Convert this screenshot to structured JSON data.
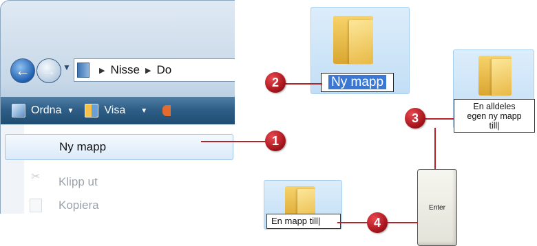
{
  "explorer": {
    "address_path": [
      "Nisse",
      "Do"
    ],
    "toolbar": {
      "organize_label": "Ordna",
      "view_label": "Visa"
    },
    "menu": {
      "new_folder": "Ny mapp",
      "cut": "Klipp ut",
      "copy": "Kopiera"
    }
  },
  "steps": {
    "one": "1",
    "two": "2",
    "three": "3",
    "four": "4"
  },
  "folders": {
    "rename_selected": "Ny mapp",
    "rename_typed_line1": "En alldeles",
    "rename_typed_line2": "egen ny mapp",
    "rename_typed_line3": "till",
    "rename_final": "En mapp till"
  },
  "keyboard": {
    "enter_label": "Enter"
  },
  "colors": {
    "callout_red": "#b4222a",
    "selection_blue": "#3a78d4",
    "toolbar_blue": "#2f5f87"
  }
}
